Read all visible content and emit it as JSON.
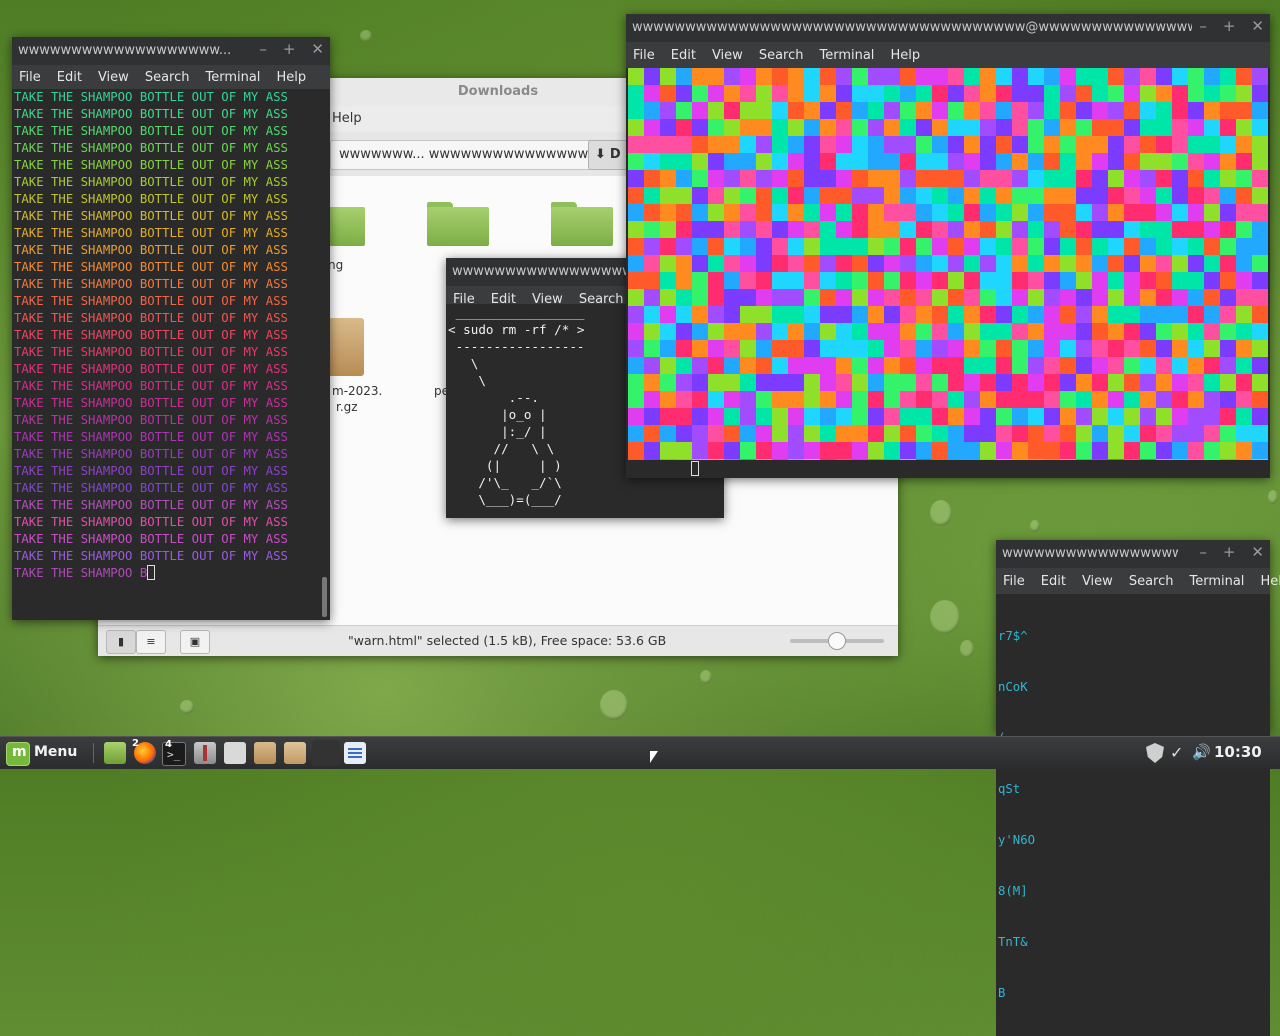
{
  "desktop": {},
  "file_manager": {
    "title": "Downloads",
    "menu_visible": "Help",
    "path_fragment": "wwwwwww... wwwwwwwwwwwwwww",
    "path_button": "D",
    "file_labels": [
      "ng",
      "m-2023.",
      "r.gz",
      "pe"
    ],
    "status_text": "\"warn.html\" selected (1.5 kB), Free space: 53.6 GB"
  },
  "term_left": {
    "title": "wwwwwwwwwwwwwwwwwww...",
    "menu": [
      "File",
      "Edit",
      "View",
      "Search",
      "Terminal",
      "Help"
    ],
    "line_text": "TAKE THE SHAMPOO BOTTLE OUT OF MY ASS",
    "line_colors": [
      "#34d399",
      "#3fd88a",
      "#52d86e",
      "#6ad654",
      "#86d23e",
      "#a3cc30",
      "#bec42a",
      "#d4ba28",
      "#e3ac2a",
      "#ec9c2e",
      "#f08a34",
      "#f2783c",
      "#f26646",
      "#f05552",
      "#ec4660",
      "#e63a6e",
      "#de327c",
      "#d42e8a",
      "#c82e98",
      "#ba30a6",
      "#ab34b2",
      "#9c3abc",
      "#8d40c4",
      "#8046cc",
      "#b050b8",
      "#e04eaa",
      "#c84ec8",
      "#9a5ae0"
    ],
    "last_line": "TAKE THE SHAMPOO B"
  },
  "term_cow": {
    "title": "wwwwwwwwwwwwwwwwwwwwwww",
    "menu": [
      "File",
      "Edit",
      "View",
      "Search",
      "T"
    ],
    "art": " _________________\n< sudo rm -rf /* >\n -----------------\n   \\\n    \\\n        .--.\n       |o_o |\n       |:_/ |\n      //   \\ \\\n     (|     | )\n    /'\\_   _/`\\\n    \\___)=(___/"
  },
  "term_rainbow": {
    "title": "wwwwwwwwwwwwwwwwwwwwwwwwwwwwwwwwwwwww@wwwwwwwwwwwwwwwwwwwwwww",
    "menu": [
      "File",
      "Edit",
      "View",
      "Search",
      "Terminal",
      "Help"
    ],
    "palette": [
      "#ff2d6f",
      "#ff4fa0",
      "#a24cff",
      "#7b3cff",
      "#1fd6ff",
      "#00e6a8",
      "#34f26a",
      "#8ee02a",
      "#ff8a1f",
      "#ff5a2a",
      "#e03cf0",
      "#23a8ff"
    ]
  },
  "term_small": {
    "title": "wwwwwwwwwwwwwwwwwww...",
    "menu": [
      "File",
      "Edit",
      "View",
      "Search",
      "Terminal",
      "Help"
    ],
    "lines": [
      "r7$^",
      "nCoK",
      "( _,",
      "qSt",
      "y'N6O",
      "8(M]",
      "TnT&",
      "B"
    ]
  },
  "taskbar": {
    "menu_label": "Menu",
    "badge_firefox": "2",
    "badge_term": "4",
    "clock": "10:30"
  }
}
